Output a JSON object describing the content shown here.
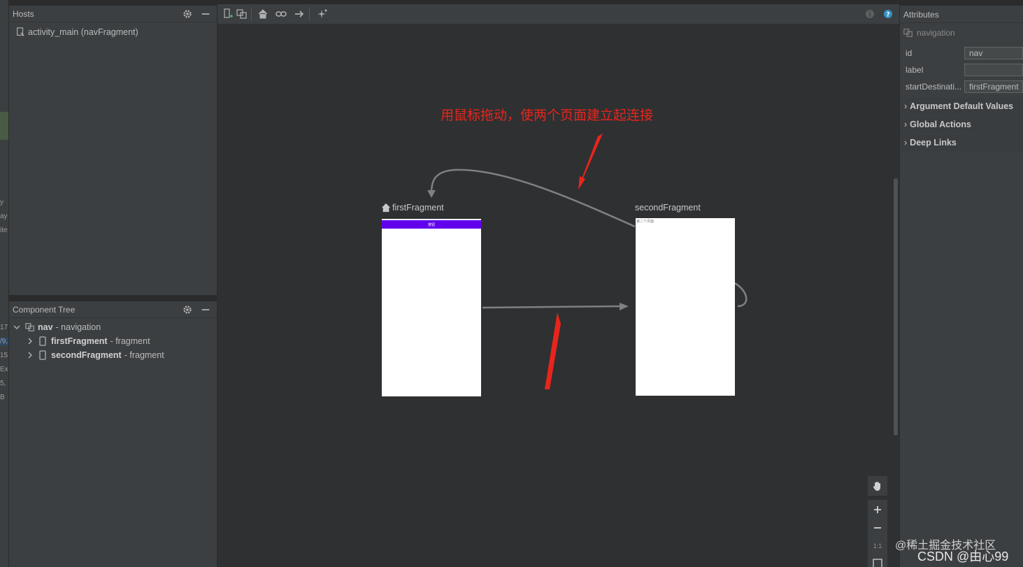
{
  "hosts": {
    "title": "Hosts",
    "items": [
      {
        "label": "activity_main (navFragment)"
      }
    ]
  },
  "component_tree": {
    "title": "Component Tree",
    "root": {
      "name": "nav",
      "type": "- navigation"
    },
    "children": [
      {
        "name": "firstFragment",
        "type": "- fragment"
      },
      {
        "name": "secondFragment",
        "type": "- fragment"
      }
    ]
  },
  "edge_fragments": [
    "y",
    "ay",
    "ite",
    "17",
    "/9,",
    "15",
    "Exa",
    "5,",
    "B"
  ],
  "canvas": {
    "annotation": "用鼠标拖动，使两个页面建立起连接",
    "first_fragment": {
      "label": "firstFragment",
      "button_text": "按钮"
    },
    "second_fragment": {
      "label": "secondFragment",
      "content_text": "第二个页面"
    }
  },
  "attributes": {
    "title": "Attributes",
    "type_label": "navigation",
    "fields": [
      {
        "label": "id",
        "value": "nav"
      },
      {
        "label": "label",
        "value": ""
      },
      {
        "label": "startDestinati...",
        "value": "firstFragment"
      }
    ],
    "sections": [
      {
        "label": "Argument Default Values"
      },
      {
        "label": "Global Actions"
      },
      {
        "label": "Deep Links"
      }
    ]
  },
  "zoom": {
    "reset_label": "1:1"
  },
  "watermark": {
    "line1": "@稀土掘金技术社区",
    "line2": "CSDN @由心99"
  },
  "colors": {
    "annotation": "#e8251c",
    "arrow": "#808080",
    "toolbar_accent": "#6200ee",
    "help": "#3592c4"
  }
}
